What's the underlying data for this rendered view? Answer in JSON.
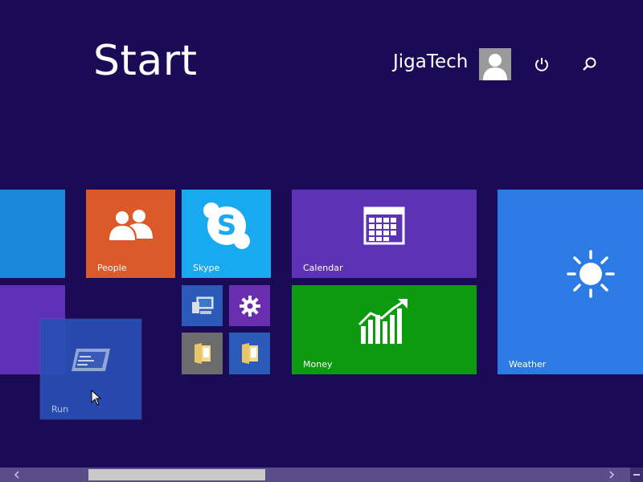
{
  "header": {
    "title": "Start",
    "user_name": "JigaTech"
  },
  "icons": {
    "power": "power-icon",
    "search": "search-icon",
    "avatar": "user-avatar-icon"
  },
  "tiles": {
    "people": {
      "label": "People",
      "color": "#dc5a2a"
    },
    "skype": {
      "label": "Skype",
      "color": "#18a9ee"
    },
    "calendar": {
      "label": "Calendar",
      "color": "#5c33b5"
    },
    "money": {
      "label": "Money",
      "color": "#0c9a0f"
    },
    "weather": {
      "label": "Weather",
      "color": "#2c7ae3"
    },
    "run": {
      "label": "Run",
      "color": "#2a4fb6"
    },
    "left_blue": {
      "color": "#1b88d9"
    },
    "left_purple": {
      "color": "#5f2fb5"
    },
    "computer": {
      "color": "#2b5ab8"
    },
    "settings": {
      "color": "#6a2fb0"
    },
    "explorer1": {
      "color": "#6c6c6c"
    },
    "explorer2": {
      "color": "#2b5ab8"
    }
  },
  "colors": {
    "background": "#1b0a55",
    "scrollbar": "#5a4d8a",
    "scroll_thumb": "#c9c9c9"
  }
}
